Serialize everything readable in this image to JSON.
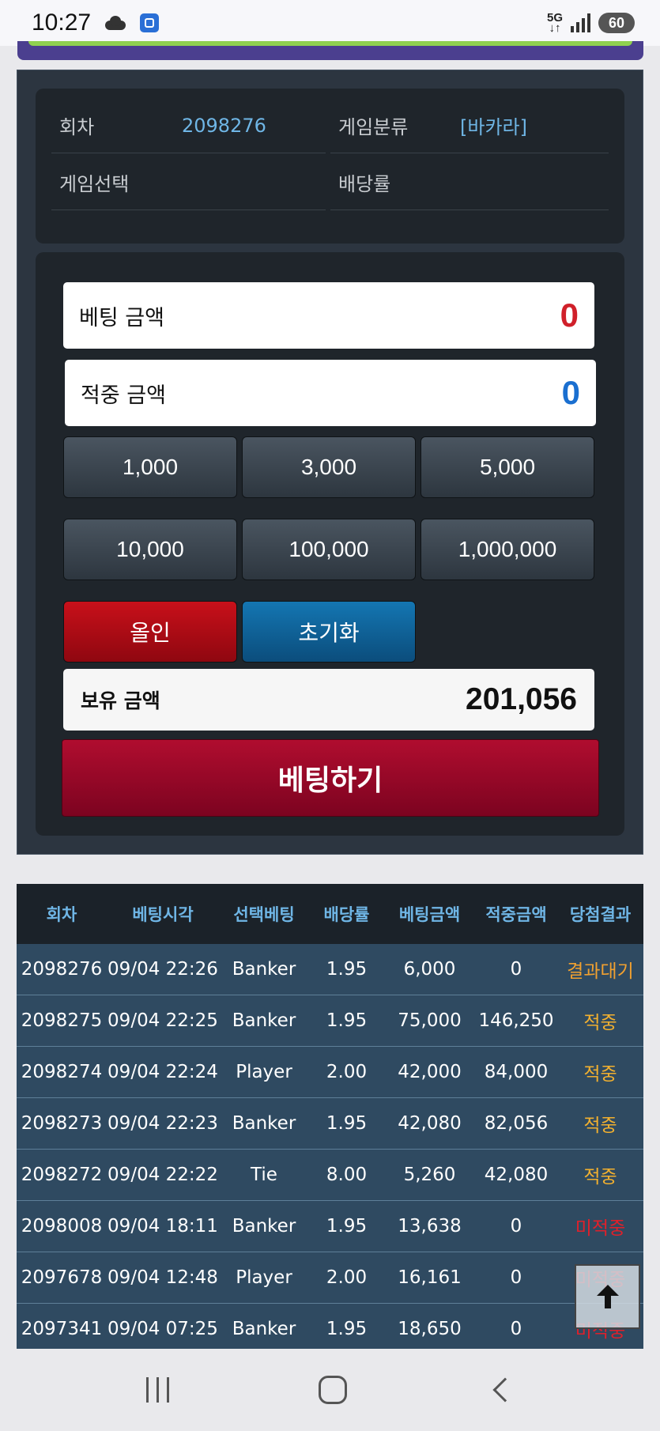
{
  "status_bar": {
    "time": "10:27",
    "network": "5G",
    "battery": "60",
    "icons": [
      "cloud-icon",
      "app-icon",
      "signal-icon",
      "battery-icon"
    ]
  },
  "info": {
    "round_label": "회차",
    "round_value": "2098276",
    "category_label": "게임분류",
    "category_value": "[바카라]",
    "selection_label": "게임선택",
    "selection_value": "",
    "odds_label": "배당률",
    "odds_value": ""
  },
  "bet": {
    "bet_amount_label": "베팅 금액",
    "bet_amount_value": "0",
    "win_amount_label": "적중 금액",
    "win_amount_value": "0",
    "chips": [
      "1,000",
      "3,000",
      "5,000",
      "10,000",
      "100,000",
      "1,000,000"
    ],
    "allin_label": "올인",
    "reset_label": "초기화",
    "holding_label": "보유 금액",
    "holding_value": "201,056",
    "submit_label": "베팅하기",
    "colors": {
      "bet_value": "#d0202a",
      "win_value": "#1a6fd0"
    }
  },
  "history": {
    "headers": [
      "회차",
      "베팅시각",
      "선택베팅",
      "배당률",
      "베팅금액",
      "적중금액",
      "당첨결과"
    ],
    "rows": [
      [
        "2098276",
        "09/04 22:26",
        "Banker",
        "1.95",
        "6,000",
        "0",
        "결과대기"
      ],
      [
        "2098275",
        "09/04 22:25",
        "Banker",
        "1.95",
        "75,000",
        "146,250",
        "적중"
      ],
      [
        "2098274",
        "09/04 22:24",
        "Player",
        "2.00",
        "42,000",
        "84,000",
        "적중"
      ],
      [
        "2098273",
        "09/04 22:23",
        "Banker",
        "1.95",
        "42,080",
        "82,056",
        "적중"
      ],
      [
        "2098272",
        "09/04 22:22",
        "Tie",
        "8.00",
        "5,260",
        "42,080",
        "적중"
      ],
      [
        "2098008",
        "09/04 18:11",
        "Banker",
        "1.95",
        "13,638",
        "0",
        "미적중"
      ],
      [
        "2097678",
        "09/04 12:48",
        "Player",
        "2.00",
        "16,161",
        "0",
        "미적중"
      ],
      [
        "2097341",
        "09/04 07:25",
        "Banker",
        "1.95",
        "18,650",
        "0",
        "미적중"
      ]
    ],
    "result_types": [
      "wait",
      "hit",
      "hit",
      "hit",
      "hit",
      "miss",
      "miss",
      "miss"
    ]
  }
}
